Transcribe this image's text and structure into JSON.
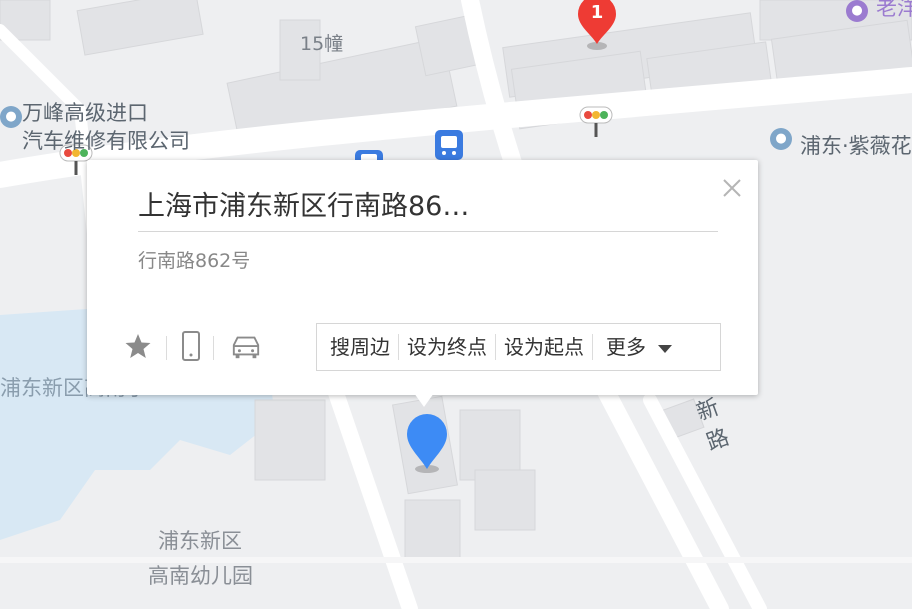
{
  "map": {
    "labels": {
      "building_15": "15幢",
      "poi_wanfeng_line1": "万峰高级进口",
      "poi_wanfeng_line2": "汽车维修有限公司",
      "poi_pudong_zi": "浦东·紫薇花",
      "poi_top_right": "老洋",
      "water_label": "浦东新区高南小",
      "kindergarten_line1": "浦东新区",
      "kindergarten_line2": "高南幼儿园",
      "road_char1": "新",
      "road_char2": "路"
    },
    "markers": {
      "numbered_marker_label": "1"
    },
    "colors": {
      "background": "#eeeff1",
      "road": "#ffffff",
      "water": "#d8e8f4",
      "marker_red": "#ee3b34",
      "marker_blue": "#3d8bf5",
      "bus_icon": "#3b7be0"
    }
  },
  "popup": {
    "title": "上海市浦东新区行南路86…",
    "address": "行南路862号",
    "actions": {
      "search_nearby": "搜周边",
      "set_destination": "设为终点",
      "set_origin": "设为起点",
      "more": "更多"
    },
    "tools": [
      "star-icon",
      "phone-icon",
      "car-icon"
    ]
  }
}
